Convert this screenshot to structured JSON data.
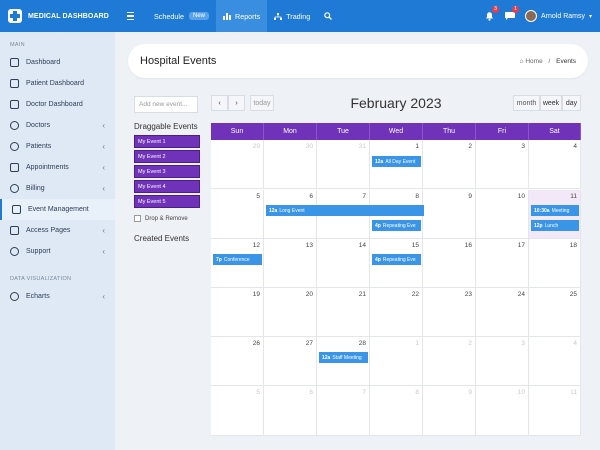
{
  "brand": {
    "title": "MEDICAL DASHBOARD"
  },
  "nav": [
    {
      "label": "Schedule",
      "badge": "New"
    },
    {
      "label": "Reports"
    },
    {
      "label": "Trading"
    }
  ],
  "notifications": {
    "bell": "3",
    "mail": "1"
  },
  "user": {
    "name": "Arnold Ramsy"
  },
  "sidebar": {
    "section_main": "MAIN",
    "items": [
      {
        "label": "Dashboard"
      },
      {
        "label": "Patient Dashboard"
      },
      {
        "label": "Doctor Dashboard"
      },
      {
        "label": "Doctors"
      },
      {
        "label": "Patients"
      },
      {
        "label": "Appointments"
      },
      {
        "label": "Billing"
      },
      {
        "label": "Event Management"
      },
      {
        "label": "Access Pages"
      },
      {
        "label": "Support"
      }
    ],
    "section_viz": "DATA VISUALIZATION",
    "viz_items": [
      {
        "label": "Echarts"
      }
    ]
  },
  "page": {
    "title": "Hospital Events",
    "crumb_home": "Home",
    "crumb_current": "Events"
  },
  "left": {
    "placeholder": "Add new event...",
    "draggable_title": "Draggable Events",
    "events": [
      "My Event 1",
      "My Event 2",
      "My Event 3",
      "My Event 4",
      "My Event 5"
    ],
    "drop_label": "Drop & Remove",
    "created_title": "Created Events"
  },
  "calendar": {
    "title": "February 2023",
    "today_label": "today",
    "views": [
      "month",
      "week",
      "day"
    ],
    "days": [
      "Sun",
      "Mon",
      "Tue",
      "Wed",
      "Thu",
      "Fri",
      "Sat"
    ],
    "weeks": [
      [
        "29",
        "30",
        "31",
        "1",
        "2",
        "3",
        "4"
      ],
      [
        "5",
        "6",
        "7",
        "8",
        "9",
        "10",
        "11"
      ],
      [
        "12",
        "13",
        "14",
        "15",
        "16",
        "17",
        "18"
      ],
      [
        "19",
        "20",
        "21",
        "22",
        "23",
        "24",
        "25"
      ],
      [
        "26",
        "27",
        "28",
        "1",
        "2",
        "3",
        "4"
      ],
      [
        "5",
        "6",
        "7",
        "8",
        "9",
        "10",
        "11"
      ]
    ],
    "events": {
      "all_day": {
        "time": "12a",
        "title": "All Day Event"
      },
      "long": {
        "time": "12a",
        "title": "Long Event"
      },
      "repeat1": {
        "time": "4p",
        "title": "Repeating Eve"
      },
      "meeting": {
        "time": "10:30a",
        "title": "Meeting"
      },
      "lunch": {
        "time": "12p",
        "title": "Lunch"
      },
      "conference": {
        "time": "7p",
        "title": "Conference"
      },
      "repeat2": {
        "time": "4p",
        "title": "Repeating Eve"
      },
      "staff": {
        "time": "12a",
        "title": "Staff Meeting"
      }
    }
  }
}
